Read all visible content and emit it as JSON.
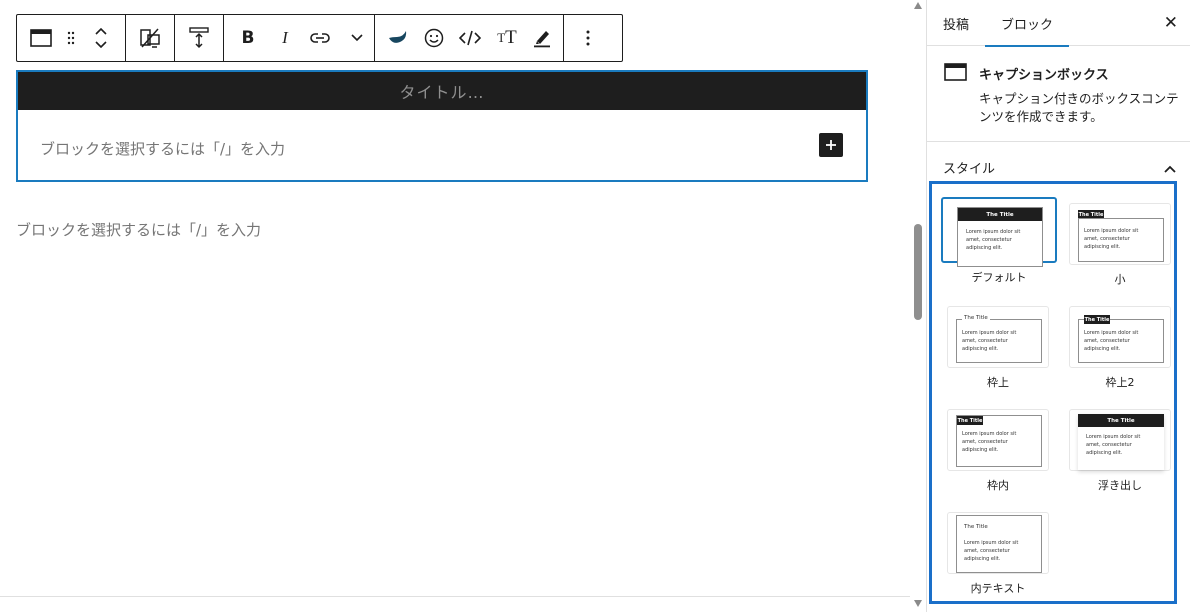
{
  "toolbar": {
    "buttons": [
      "block-type",
      "drag",
      "move-up-down",
      "hide-device",
      "align-height",
      "bold",
      "italic",
      "link",
      "more-formats",
      "fill-tool",
      "emoji",
      "code",
      "text-size",
      "highlighter",
      "options"
    ],
    "text_size_label": "TT"
  },
  "caption_block": {
    "title_placeholder": "タイトル…",
    "inner_placeholder": "ブロックを選択するには「/」を入力"
  },
  "editor": {
    "outer_placeholder": "ブロックを選択するには「/」を入力"
  },
  "sidebar": {
    "tabs": [
      "投稿",
      "ブロック"
    ],
    "active_tab": "ブロック",
    "close_label": "✕",
    "block_card": {
      "title": "キャプションボックス",
      "description": "キャプション付きのボックスコンテンツを作成できます。"
    },
    "styles_heading": "スタイル",
    "styles": [
      {
        "label": "デフォルト",
        "selected": true
      },
      {
        "label": "小",
        "selected": false
      },
      {
        "label": "枠上",
        "selected": false
      },
      {
        "label": "枠上2",
        "selected": false
      },
      {
        "label": "枠内",
        "selected": false
      },
      {
        "label": "浮き出し",
        "selected": false
      },
      {
        "label": "内テキスト",
        "selected": false
      }
    ],
    "preview": {
      "title": "The Title",
      "body": [
        "Lorem ipsum dolor sit",
        "amet, consectetur",
        "adipiscing elit."
      ]
    }
  },
  "colors": {
    "accent": "#1a7bbf",
    "panel_border": "#1a6fc9",
    "dark": "#1e1e1e",
    "placeholder": "#757575"
  }
}
